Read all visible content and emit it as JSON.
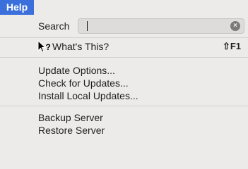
{
  "menubar": {
    "title": "Help"
  },
  "search": {
    "label": "Search",
    "value": "",
    "placeholder": ""
  },
  "items": {
    "whats_this": {
      "label": "What's This?",
      "shortcut": "⇧F1"
    },
    "update_options": {
      "label": "Update Options..."
    },
    "check_updates": {
      "label": "Check for Updates..."
    },
    "install_local": {
      "label": "Install Local Updates..."
    },
    "backup_server": {
      "label": "Backup Server"
    },
    "restore_server": {
      "label": "Restore Server"
    }
  },
  "icons": {
    "clear": "clear-search-icon",
    "whats_this": "help-cursor-icon"
  }
}
